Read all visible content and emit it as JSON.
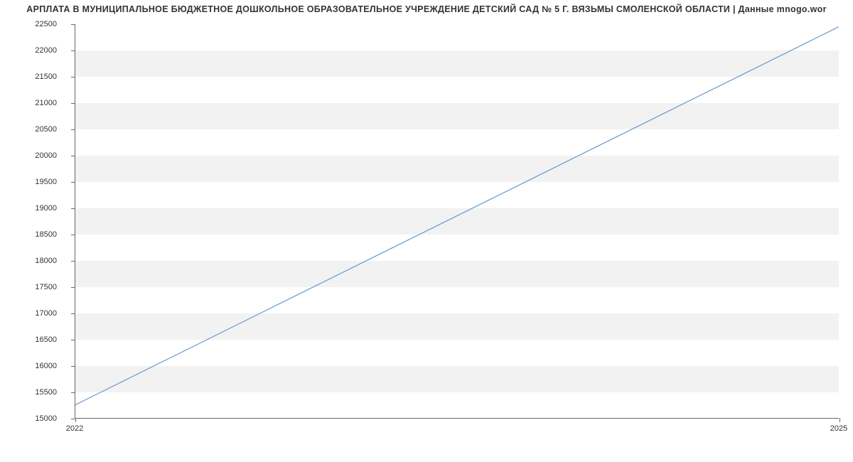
{
  "chart_data": {
    "type": "line",
    "title": "АРПЛАТА В МУНИЦИПАЛЬНОЕ БЮДЖЕТНОЕ ДОШКОЛЬНОЕ ОБРАЗОВАТЕЛЬНОЕ УЧРЕЖДЕНИЕ ДЕТСКИЙ САД № 5 Г. ВЯЗЬМЫ СМОЛЕНСКОЙ ОБЛАСТИ | Данные mnogo.wor",
    "x": [
      2022,
      2025
    ],
    "values": [
      15250,
      22450
    ],
    "xlabel": "",
    "ylabel": "",
    "xlim": [
      2022,
      2025
    ],
    "ylim": [
      15000,
      22500
    ],
    "y_ticks": [
      15000,
      15500,
      16000,
      16500,
      17000,
      17500,
      18000,
      18500,
      19000,
      19500,
      20000,
      20500,
      21000,
      21500,
      22000,
      22500
    ],
    "x_ticks": [
      2022,
      2025
    ]
  }
}
